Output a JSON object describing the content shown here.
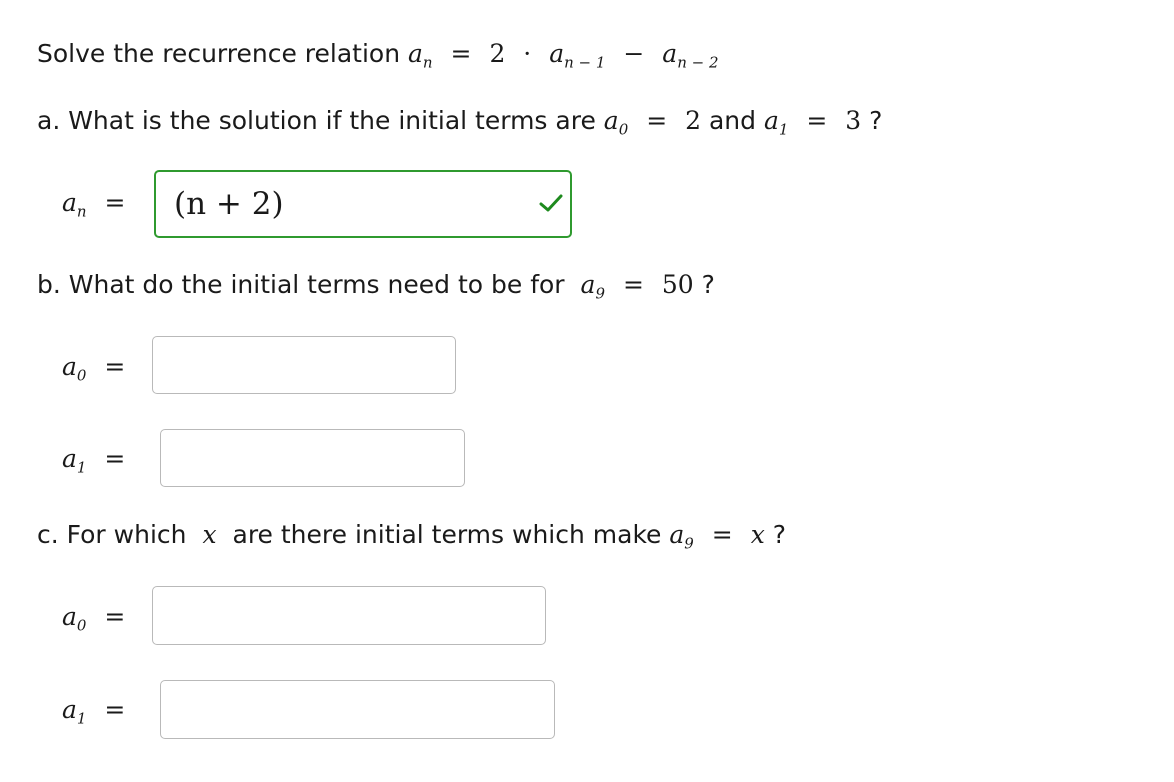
{
  "problem": {
    "intro": "Solve the recurrence relation",
    "relation": {
      "lhs": "a",
      "lhs_sub": "n",
      "eq": "=",
      "coef": "2",
      "dot": "·",
      "term1": "a",
      "term1_sub": "n − 1",
      "minus": "−",
      "term2": "a",
      "term2_sub": "n − 2"
    }
  },
  "part_a": {
    "question": "a. What is the solution if the initial terms are",
    "a0_var": "a",
    "a0_sub": "0",
    "a0_eq": "=",
    "a0_val": "2",
    "and": "and",
    "a1_var": "a",
    "a1_sub": "1",
    "a1_eq": "=",
    "a1_val": "3",
    "qmark": "?",
    "answer_label_var": "a",
    "answer_label_sub": "n",
    "answer_label_eq": "=",
    "answer_value": "(n + 2)",
    "answer_status": "correct"
  },
  "part_b": {
    "question": "b. What do the initial terms need to be for",
    "var": "a",
    "sub": "9",
    "eq": "=",
    "val": "50",
    "qmark": "?",
    "fields": [
      {
        "var": "a",
        "sub": "0",
        "eq": "=",
        "value": ""
      },
      {
        "var": "a",
        "sub": "1",
        "eq": "=",
        "value": ""
      }
    ]
  },
  "part_c": {
    "q_prefix": "c. For which",
    "q_var": "x",
    "q_suffix": "are there initial terms which make",
    "var": "a",
    "sub": "9",
    "eq": "=",
    "rhs": "x",
    "qmark": "?",
    "fields": [
      {
        "var": "a",
        "sub": "0",
        "eq": "=",
        "value": ""
      },
      {
        "var": "a",
        "sub": "1",
        "eq": "=",
        "value": ""
      }
    ]
  },
  "colors": {
    "correct_border": "#2f9a2f",
    "default_border": "#b9b9b9",
    "check": "#1e8a1e"
  }
}
